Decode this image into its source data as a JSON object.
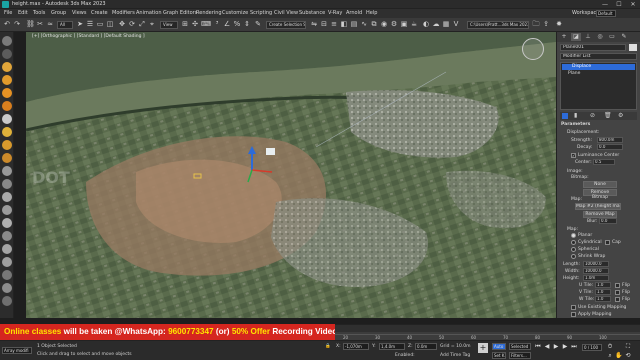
{
  "window": {
    "title": "height.max - Autodesk 3ds Max 2023",
    "controls": [
      "—",
      "☐",
      "✕"
    ]
  },
  "menu": {
    "items": [
      "File",
      "Edit",
      "Tools",
      "Group",
      "Views",
      "Create",
      "Modifiers",
      "Animation",
      "Graph Editors",
      "Rendering",
      "Customize",
      "Scripting",
      "Civil View",
      "Substance",
      "V-Ray",
      "Arnold",
      "Help"
    ],
    "workspaces_label": "Workspaces:",
    "workspace_value": "Default"
  },
  "toolbar": {
    "selection_filter": "All",
    "view_dropdown": "View",
    "selection_set": "Create Selection Se",
    "path": "C:\\Users\\Pratt...3ds Max 2023"
  },
  "viewport": {
    "label": "[+] [Orthographic ] [Standard ] [Default Shading ]",
    "watermark": "DOT"
  },
  "command_panel": {
    "object_name": "Plane001",
    "modifier_list": "Modifier List",
    "stack": [
      "Displace",
      "Plane"
    ],
    "rollout_title": "Parameters",
    "displacement_label": "Displacement:",
    "strength_label": "Strength:",
    "strength_value": "800.0m",
    "decay_label": "Decay:",
    "decay_value": "0.0",
    "luminance_center_label": "Luminance Center",
    "center_label": "Center:",
    "center_value": "0.5",
    "image_label": "Image:",
    "bitmap_label": "Bitmap:",
    "bitmap_button": "None",
    "remove_bitmap": "Remove Bitmap",
    "map_label": "Map:",
    "map_button": "Map #2 (height map (2)...",
    "remove_map": "Remove Map",
    "blur_label": "Blur:",
    "blur_value": "0.0",
    "map_section": "Map:",
    "planar": "Planar",
    "cylindrical": "Cylindrical",
    "cap": "Cap",
    "spherical": "Spherical",
    "shrink_wrap": "Shrink Wrap",
    "length_label": "Length:",
    "length_value": "10000.0",
    "width_label": "Width:",
    "width_value": "10000.0",
    "height_label": "Height:",
    "height_value": "1.0m",
    "u_tile_label": "U Tile:",
    "u_tile_value": "1.0",
    "v_tile_label": "V Tile:",
    "v_tile_value": "1.0",
    "w_tile_label": "W Tile:",
    "w_tile_value": "1.0",
    "flip_label": "Flip",
    "use_existing_mapping": "Use Existing Mapping",
    "apply_mapping": "Apply Mapping"
  },
  "banner": {
    "part1": "Online classes",
    "part2": " will be taken @WhatsApp: ",
    "phone": "9600773347",
    "part3": " (or) ",
    "offer": "50% Offer",
    "part4": " Recording Videos"
  },
  "timeline": {
    "frame_counter": "0 / 100",
    "ticks": [
      "20",
      "30",
      "40",
      "50",
      "60",
      "70",
      "80",
      "90",
      "100"
    ]
  },
  "status": {
    "script_box": "Array modifi",
    "selected": "1 Object Selected",
    "prompt": "Click and drag to select and move objects",
    "x_label": "X:",
    "x_value": "-1,070m",
    "y_label": "Y:",
    "y_value": "1,4.0m",
    "z_label": "Z:",
    "z_value": "0.0m",
    "enabled": "Enabled:",
    "grid": "Grid = 10.0m",
    "add_time_tag": "Add Time Tag",
    "auto_key": "Auto",
    "selected_dd": "Selected",
    "set_key": "Set K.",
    "filters": "Filters..."
  },
  "colors": {
    "banner": "#d5261f",
    "banner_highlight": "#ffe400",
    "selection_blue": "#2d6bd8"
  }
}
